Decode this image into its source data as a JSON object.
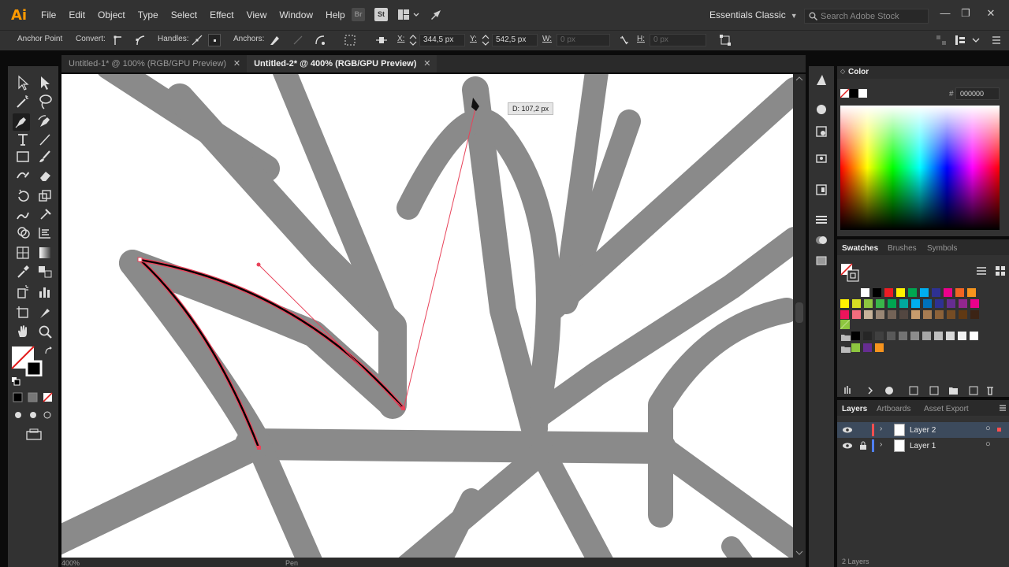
{
  "app": {
    "logo": "Ai"
  },
  "menu": [
    "File",
    "Edit",
    "Object",
    "Type",
    "Select",
    "Effect",
    "View",
    "Window",
    "Help"
  ],
  "app_icons": {
    "bridge": "Br",
    "stock": "St"
  },
  "workspace": {
    "label": "Essentials Classic"
  },
  "search": {
    "placeholder": "Search Adobe Stock"
  },
  "control_bar": {
    "tool_label": "Anchor Point",
    "convert_label": "Convert:",
    "handles_label": "Handles:",
    "anchors_label": "Anchors:",
    "x_label": "X:",
    "x_value": "344,5 px",
    "y_label": "Y:",
    "y_value": "542,5 px",
    "w_label": "W:",
    "w_value": "0 px",
    "h_label": "H:",
    "h_value": "0 px"
  },
  "tabs": [
    {
      "label": "Untitled-1* @ 100% (RGB/GPU Preview)",
      "close": "✕"
    },
    {
      "label": "Untitled-2* @ 400% (RGB/GPU Preview)",
      "close": "✕"
    }
  ],
  "canvas": {
    "tooltip": "D: 107,2 px"
  },
  "status": {
    "zoom": "400%",
    "tool": "Pen"
  },
  "color_panel": {
    "title": "Color",
    "hex_prefix": "#",
    "hex_value": "000000"
  },
  "swatch_panel": {
    "tabs": [
      "Swatches",
      "Brushes",
      "Symbols"
    ],
    "row1": [
      "#ffffff",
      "#000000",
      "#ed1c24",
      "#fff200",
      "#00a651",
      "#00aeef",
      "#2e3192",
      "#ec008c",
      "#f26522",
      "#f7941d"
    ],
    "row2": [
      "#fff200",
      "#d7df23",
      "#8dc63f",
      "#39b54a",
      "#00a651",
      "#00a99d",
      "#00aeef",
      "#0072bc",
      "#2e3192",
      "#662d91",
      "#92278f",
      "#ec008c"
    ],
    "row3": [
      "#ed145b",
      "#f26d7d",
      "#c7b299",
      "#998675",
      "#736357",
      "#534741",
      "#c69c6d",
      "#a67c52",
      "#8c6239",
      "#754c24",
      "#603913",
      "#3c2415"
    ],
    "gray_row": [
      "#000000",
      "#262626",
      "#404040",
      "#595959",
      "#737373",
      "#8c8c8c",
      "#a6a6a6",
      "#bfbfbf",
      "#d9d9d9",
      "#f2f2f2",
      "#ffffff"
    ],
    "group_row": [
      "#8dc63f",
      "#662d91",
      "#f7941d"
    ]
  },
  "layers_panel": {
    "tabs": [
      "Layers",
      "Artboards",
      "Asset Export"
    ],
    "layers": [
      {
        "name": "Layer 2",
        "color": "#ff4f4f"
      },
      {
        "name": "Layer 1",
        "color": "#4f7fff"
      }
    ],
    "footer": "2 Layers"
  }
}
